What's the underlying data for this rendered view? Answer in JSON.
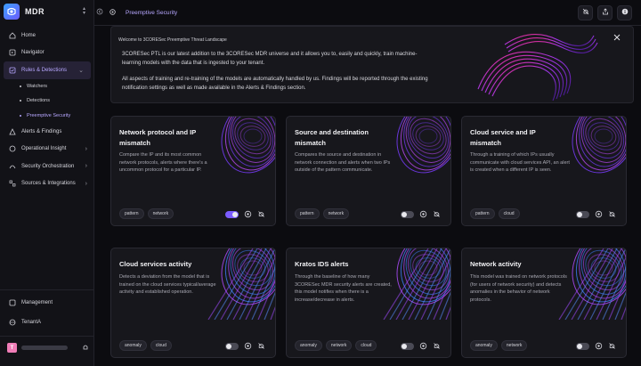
{
  "app": {
    "name": "MDR"
  },
  "sidebar": {
    "items": [
      {
        "label": "Home",
        "icon": "home-icon"
      },
      {
        "label": "Navigator",
        "icon": "compass-icon"
      },
      {
        "label": "Rules & Detections",
        "icon": "rules-icon",
        "active": true,
        "subitems": [
          {
            "label": "Watchers"
          },
          {
            "label": "Detections"
          },
          {
            "label": "Preemptive Security",
            "active": true
          }
        ]
      },
      {
        "label": "Alerts & Findings",
        "icon": "alert-icon"
      },
      {
        "label": "Operational Insight",
        "icon": "insight-icon"
      },
      {
        "label": "Security Orchestration",
        "icon": "orchestration-icon"
      },
      {
        "label": "Sources & Integrations",
        "icon": "integrations-icon"
      }
    ],
    "management_label": "Management",
    "tenant": {
      "label": "TenantA",
      "initial": "T"
    }
  },
  "topbar": {
    "title": "Preemptive Security"
  },
  "welcome": {
    "heading": "Welcome to 3CORESec Preemptive Threat Landscape",
    "para1": "3CORESec PTL is our latest addition to the 3CORESec MDR universe and it allows you to, easily and quickly, train machine-learning models with the data that is ingested to your tenant.",
    "para2": "All aspects of training and re-training of the models are automatically handled by us. Findings will be reported through the existing notification settings as well as made available in the Alerts & Findings section."
  },
  "cards": [
    {
      "title": "Network protocol and IP mismatch",
      "desc": "Compare the IP and its most common network protocols, alerts where there's a uncommon protocol for a particular IP.",
      "tags": [
        "pattern",
        "network"
      ],
      "enabled": true
    },
    {
      "title": "Source and destination mismatch",
      "desc": "Compares the source and destination in network connection and alerts when two IPs outside of the pattern communicate.",
      "tags": [
        "pattern",
        "network"
      ],
      "enabled": false
    },
    {
      "title": "Cloud service and IP mismatch",
      "desc": "Through a training of which IPs usually communicate with cloud services API, an alert is created when a different IP is seen.",
      "tags": [
        "pattern",
        "cloud"
      ],
      "enabled": false
    },
    {
      "title": "Cloud services activity",
      "desc": "Detects a deviation from the model that is trained on the cloud services typical/average activity and established operation.",
      "tags": [
        "anomaly",
        "cloud"
      ],
      "enabled": false
    },
    {
      "title": "Kratos IDS alerts",
      "desc": "Through the baseline of how many 3CORESec MDR security alerts are created, this model notifies when there is a increase/decrease in alerts.",
      "tags": [
        "anomaly",
        "network",
        "cloud"
      ],
      "enabled": false
    },
    {
      "title": "Network activity",
      "desc": "This model was trained on network protocols (for users of network security) and detects anomalies in the behavior of network protocols.",
      "tags": [
        "anomaly",
        "network"
      ],
      "enabled": false
    }
  ],
  "colors": {
    "accent": "#7b5cff",
    "accent_text": "#b7a7ff",
    "background": "#0c0c10",
    "card": "#17171c"
  }
}
